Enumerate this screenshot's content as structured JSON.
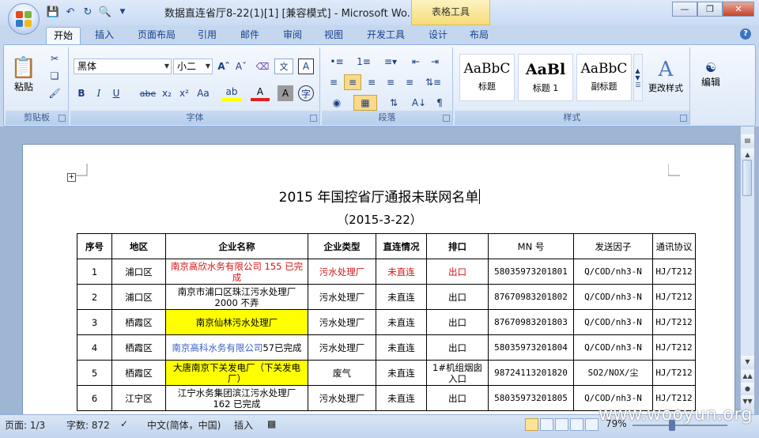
{
  "window": {
    "title": "数据直连省厅8-22(1)[1] [兼容模式] - Microsoft Wo...",
    "context_tab": "表格工具",
    "controls": {
      "minimize": "—",
      "restore": "❐",
      "close": "✕"
    }
  },
  "qat": [
    "save-icon",
    "undo-icon",
    "redo-icon",
    "print-preview-icon",
    "customize-icon"
  ],
  "tabs": [
    "开始",
    "插入",
    "页面布局",
    "引用",
    "邮件",
    "审阅",
    "视图",
    "开发工具",
    "设计",
    "布局"
  ],
  "active_tab": "开始",
  "ribbon": {
    "clipboard": {
      "label": "剪贴板",
      "paste": "粘贴"
    },
    "font": {
      "label": "字体",
      "family": "黑体",
      "size": "小二",
      "buttons": [
        "B",
        "I",
        "U",
        "abe",
        "x₂",
        "x²",
        "Aa"
      ]
    },
    "paragraph": {
      "label": "段落"
    },
    "styles": {
      "label": "样式",
      "change": "更改样式",
      "items": [
        {
          "sample": "AaBbC",
          "name": "标题"
        },
        {
          "sample": "AaBl",
          "name": "标题 1"
        },
        {
          "sample": "AaBbC",
          "name": "副标题"
        }
      ]
    },
    "editing": {
      "label": "编辑"
    }
  },
  "document": {
    "title": "2015 年国控省厅通报未联网名单",
    "date": "（2015-3-22）",
    "headers": [
      "序号",
      "地区",
      "企业名称",
      "企业类型",
      "直连情况",
      "排口",
      "MN 号",
      "发送因子",
      "通讯协议"
    ],
    "rows": [
      {
        "no": "1",
        "area": "浦口区",
        "name": "南京高欣水务有限公司 155 已完成",
        "type": "污水处理厂",
        "status": "未直连",
        "outlet": "出口",
        "mn": "58035973201801",
        "factor": "Q/COD/nh3-N",
        "proto": "HJ/T212"
      },
      {
        "no": "2",
        "area": "浦口区",
        "name": "南京市浦口区珠江污水处理厂 2000 不弄",
        "type": "污水处理厂",
        "status": "未直连",
        "outlet": "出口",
        "mn": "87670983201802",
        "factor": "Q/COD/nh3-N",
        "proto": "HJ/T212"
      },
      {
        "no": "3",
        "area": "栖霞区",
        "name": "南京仙林污水处理厂",
        "type": "污水处理厂",
        "status": "未直连",
        "outlet": "出口",
        "mn": "87670983201803",
        "factor": "Q/COD/nh3-N",
        "proto": "HJ/T212"
      },
      {
        "no": "4",
        "area": "栖霞区",
        "name": "南京高科水务有限公司",
        "name_suffix": "57已完成",
        "type": "污水处理厂",
        "status": "未直连",
        "outlet": "出口",
        "mn": "58035973201804",
        "factor": "Q/COD/nh3-N",
        "proto": "HJ/T212"
      },
      {
        "no": "5",
        "area": "栖霞区",
        "name": "大唐南京下关发电厂（下关发电厂）",
        "type": "废气",
        "status": "未直连",
        "outlet": "1#机组烟囱入口",
        "mn": "98724113201820",
        "factor": "SO2/NOX/尘",
        "proto": "HJ/T212"
      },
      {
        "no": "6",
        "area": "江宁区",
        "name": "江宁水务集团滨江污水处理厂 162 已完成",
        "type": "污水处理厂",
        "status": "未直连",
        "outlet": "出口",
        "mn": "58035973201805",
        "factor": "Q/COD/nh3-N",
        "proto": "HJ/T212"
      }
    ]
  },
  "status": {
    "page": "页面: 1/3",
    "words": "字数: 872",
    "lang": "中文(简体，中国)",
    "insert": "插入",
    "zoom": "79%"
  },
  "watermark": "www.wooyun.org",
  "colors": {
    "red": "#d61414",
    "blue": "#3a5fc8",
    "highlight": "#ffff00"
  }
}
